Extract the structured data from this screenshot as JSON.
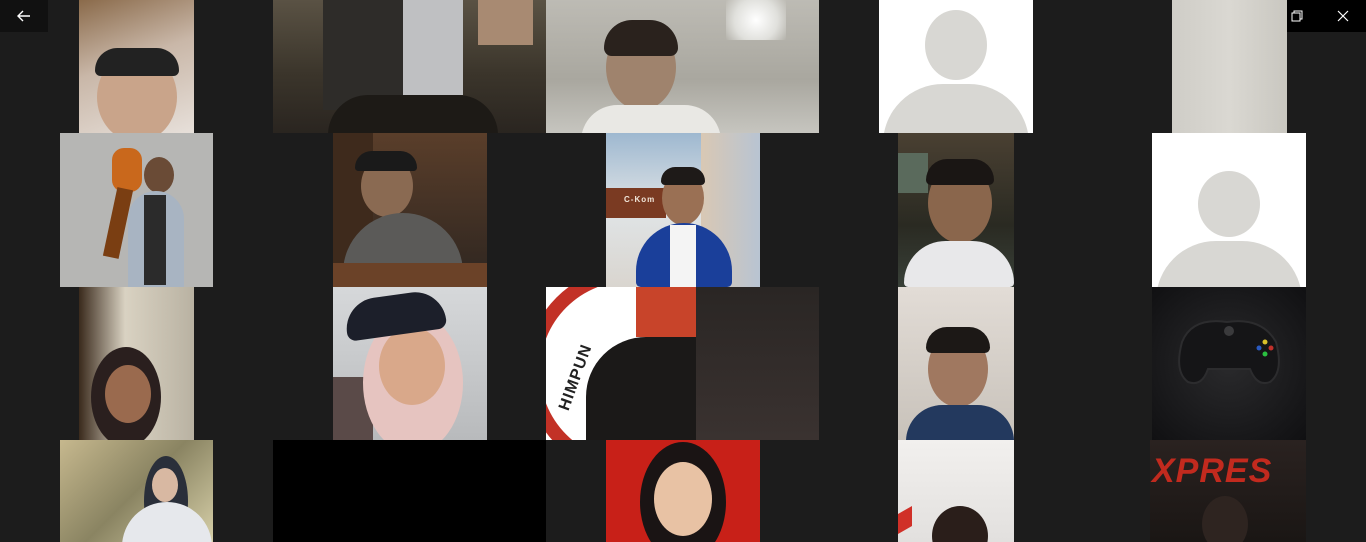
{
  "window": {
    "back_icon": "arrow-left-icon",
    "minimize_icon": "minimize-icon",
    "restore_icon": "restore-icon",
    "close_icon": "close-icon"
  },
  "overlays": {
    "himpunan_text": "HIMPUN",
    "xpres_text": "XPRES",
    "banner_text": "C-Kom"
  },
  "colors": {
    "background": "#1c1c1c",
    "avatar_bg": "#ffffff",
    "avatar_fg": "#d8d7d3",
    "titlebar": "#000000"
  }
}
